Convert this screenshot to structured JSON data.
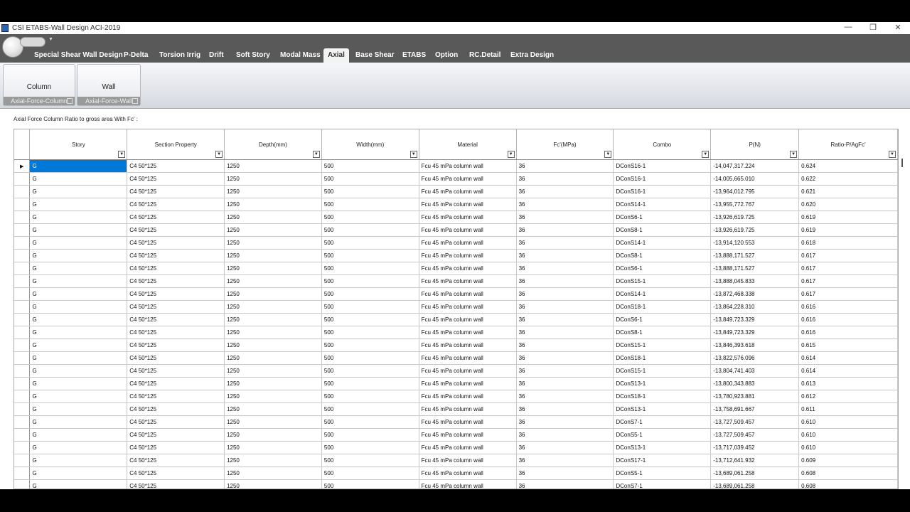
{
  "window": {
    "title": "CSI ETABS-Wall Design  ACI-2019",
    "min": "—",
    "max": "❐",
    "close": "✕"
  },
  "tabs": [
    "Special Shear Wall Design",
    "P-Delta",
    "Torsion Irrig",
    "Drift",
    "Soft Story",
    "Modal Mass",
    "Axial",
    "Base Shear",
    "ETABS",
    "Option",
    "RC.Detail",
    "Extra Design"
  ],
  "active_tab": "Axial",
  "ribbon": {
    "groups": [
      {
        "button": "Column",
        "label": "Axial-Force-Column"
      },
      {
        "button": "Wall",
        "label": "Axial-Force-Wall"
      }
    ]
  },
  "caption": "Axial Force Column Ratio to gross area With Fc' :",
  "table": {
    "columns": [
      "Story",
      "Section Property",
      "Depth(mm)",
      "Width(mm)",
      "Material",
      "Fc'(MPa)",
      "Combo",
      "P(N)",
      "Ratio-P/AgFc'"
    ],
    "row_marker": "▶",
    "rows": [
      [
        "G",
        "C4    50*125",
        "1250",
        "500",
        "Fcu 45 mPa column wall",
        "36",
        "DConS16-1",
        "-14,047,317.224",
        "0.624"
      ],
      [
        "G",
        "C4    50*125",
        "1250",
        "500",
        "Fcu 45 mPa column wall",
        "36",
        "DConS16-1",
        "-14,005,665.010",
        "0.622"
      ],
      [
        "G",
        "C4    50*125",
        "1250",
        "500",
        "Fcu 45 mPa column wall",
        "36",
        "DConS16-1",
        "-13,964,012.795",
        "0.621"
      ],
      [
        "G",
        "C4    50*125",
        "1250",
        "500",
        "Fcu 45 mPa column wall",
        "36",
        "DConS14-1",
        "-13,955,772.767",
        "0.620"
      ],
      [
        "G",
        "C4    50*125",
        "1250",
        "500",
        "Fcu 45 mPa column wall",
        "36",
        "DConS6-1",
        "-13,926,619.725",
        "0.619"
      ],
      [
        "G",
        "C4    50*125",
        "1250",
        "500",
        "Fcu 45 mPa column wall",
        "36",
        "DConS8-1",
        "-13,926,619.725",
        "0.619"
      ],
      [
        "G",
        "C4    50*125",
        "1250",
        "500",
        "Fcu 45 mPa column wall",
        "36",
        "DConS14-1",
        "-13,914,120.553",
        "0.618"
      ],
      [
        "G",
        "C4    50*125",
        "1250",
        "500",
        "Fcu 45 mPa column wall",
        "36",
        "DConS8-1",
        "-13,888,171.527",
        "0.617"
      ],
      [
        "G",
        "C4    50*125",
        "1250",
        "500",
        "Fcu 45 mPa column wall",
        "36",
        "DConS6-1",
        "-13,888,171.527",
        "0.617"
      ],
      [
        "G",
        "C4    50*125",
        "1250",
        "500",
        "Fcu 45 mPa column wall",
        "36",
        "DConS15-1",
        "-13,888,045.833",
        "0.617"
      ],
      [
        "G",
        "C4    50*125",
        "1250",
        "500",
        "Fcu 45 mPa column wall",
        "36",
        "DConS14-1",
        "-13,872,468.338",
        "0.617"
      ],
      [
        "G",
        "C4    50*125",
        "1250",
        "500",
        "Fcu 45 mPa column wall",
        "36",
        "DConS18-1",
        "-13,864,228.310",
        "0.616"
      ],
      [
        "G",
        "C4    50*125",
        "1250",
        "500",
        "Fcu 45 mPa column wall",
        "36",
        "DConS6-1",
        "-13,849,723.329",
        "0.616"
      ],
      [
        "G",
        "C4    50*125",
        "1250",
        "500",
        "Fcu 45 mPa column wall",
        "36",
        "DConS8-1",
        "-13,849,723.329",
        "0.616"
      ],
      [
        "G",
        "C4    50*125",
        "1250",
        "500",
        "Fcu 45 mPa column wall",
        "36",
        "DConS15-1",
        "-13,846,393.618",
        "0.615"
      ],
      [
        "G",
        "C4    50*125",
        "1250",
        "500",
        "Fcu 45 mPa column wall",
        "36",
        "DConS18-1",
        "-13,822,576.096",
        "0.614"
      ],
      [
        "G",
        "C4    50*125",
        "1250",
        "500",
        "Fcu 45 mPa column wall",
        "36",
        "DConS15-1",
        "-13,804,741.403",
        "0.614"
      ],
      [
        "G",
        "C4    50*125",
        "1250",
        "500",
        "Fcu 45 mPa column wall",
        "36",
        "DConS13-1",
        "-13,800,343.883",
        "0.613"
      ],
      [
        "G",
        "C4    50*125",
        "1250",
        "500",
        "Fcu 45 mPa column wall",
        "36",
        "DConS18-1",
        "-13,780,923.881",
        "0.612"
      ],
      [
        "G",
        "C4    50*125",
        "1250",
        "500",
        "Fcu 45 mPa column wall",
        "36",
        "DConS13-1",
        "-13,758,691.667",
        "0.611"
      ],
      [
        "G",
        "C4    50*125",
        "1250",
        "500",
        "Fcu 45 mPa column wall",
        "36",
        "DConS7-1",
        "-13,727,509.457",
        "0.610"
      ],
      [
        "G",
        "C4    50*125",
        "1250",
        "500",
        "Fcu 45 mPa column wall",
        "36",
        "DConS5-1",
        "-13,727,509.457",
        "0.610"
      ],
      [
        "G",
        "C4    50*125",
        "1250",
        "500",
        "Fcu 45 mPa column wall",
        "36",
        "DConS13-1",
        "-13,717,039.452",
        "0.610"
      ],
      [
        "G",
        "C4    50*125",
        "1250",
        "500",
        "Fcu 45 mPa column wall",
        "36",
        "DConS17-1",
        "-13,712,641.932",
        "0.609"
      ],
      [
        "G",
        "C4    50*125",
        "1250",
        "500",
        "Fcu 45 mPa column wall",
        "36",
        "DConS5-1",
        "-13,689,061.258",
        "0.608"
      ],
      [
        "G",
        "C4    50*125",
        "1250",
        "500",
        "Fcu 45 mPa column wall",
        "36",
        "DConS7-1",
        "-13,689,061.258",
        "0.608"
      ]
    ]
  },
  "colors": {
    "ribbon_bar": "#595959",
    "selection": "#0078d7",
    "app_icon": "#2b66b3"
  }
}
